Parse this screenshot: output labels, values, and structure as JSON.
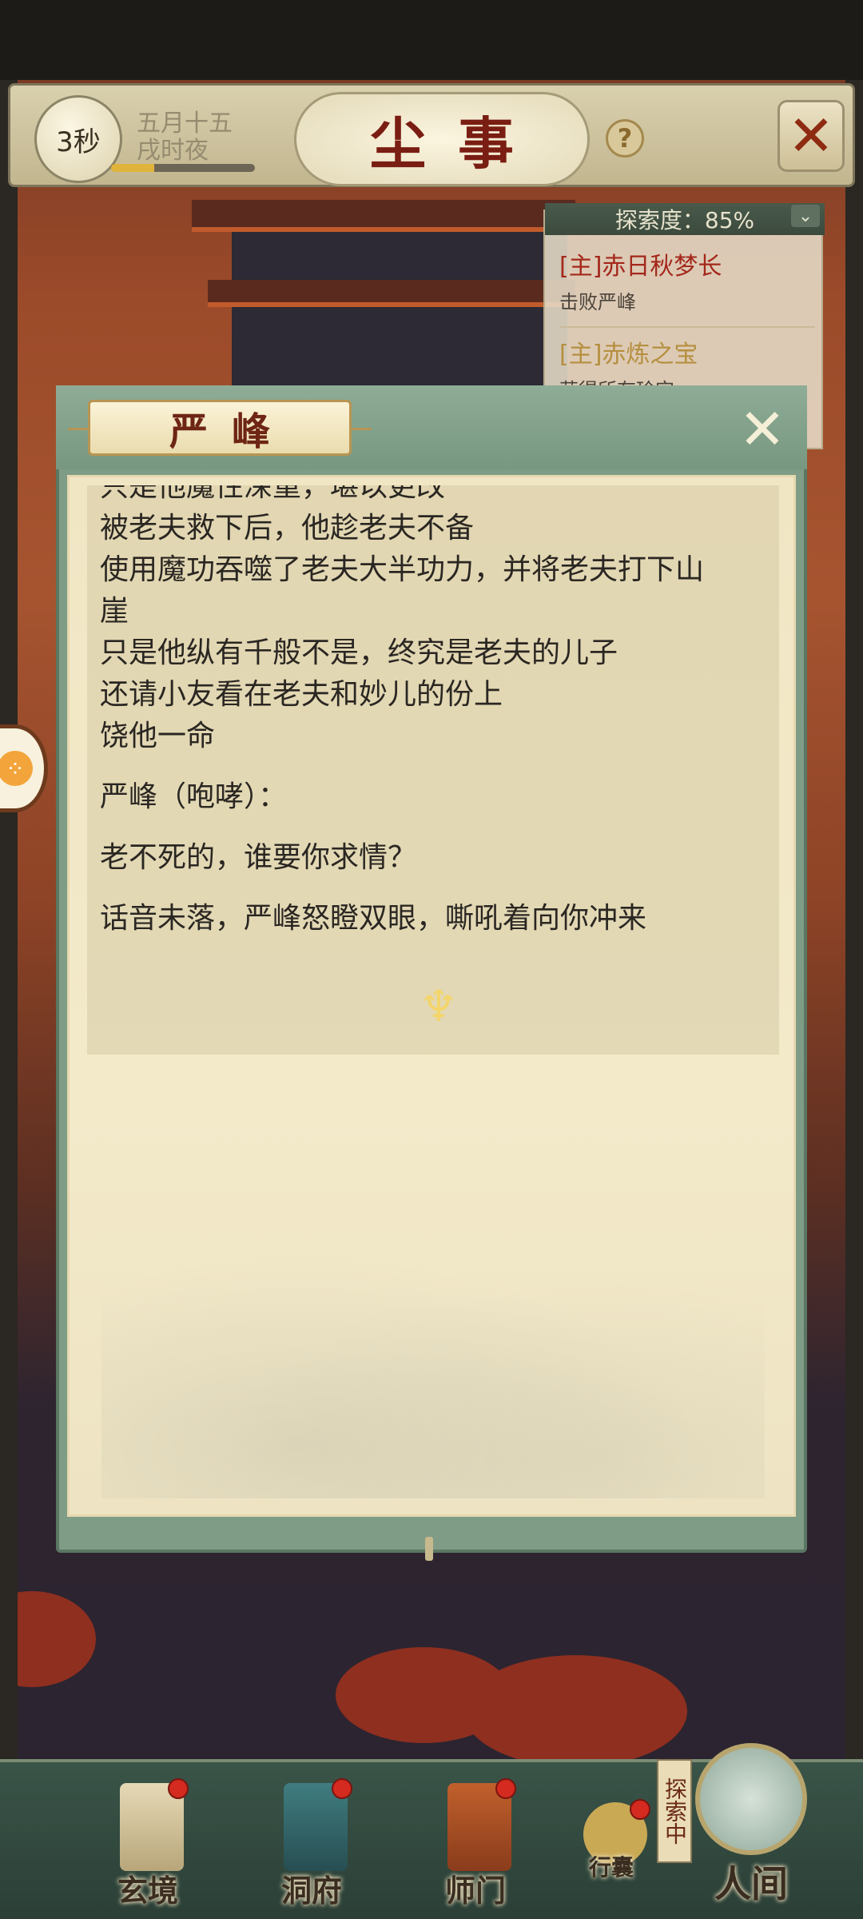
{
  "top_bar": {
    "timer": "3秒",
    "date_line1": "五月十五",
    "date_line2": "戌时夜",
    "progress": 0.3,
    "title": "尘事",
    "help_icon": "question-icon",
    "menu_icon": "crossed-swords-icon"
  },
  "quest_panel": {
    "explore_label": "探索度：85%",
    "quests": [
      {
        "title": "[主]赤日秋梦长",
        "subtitle": "击败严峰",
        "color": "#a4281b"
      },
      {
        "title": "[主]赤炼之宝",
        "subtitle": "获得所有珍宝",
        "color": "#b58f3f"
      }
    ]
  },
  "dialog": {
    "speaker": "严峰",
    "close_icon": "close-icon",
    "continue_icon": "continue-arrow-icon",
    "paragraphs": [
      [
        "只是他魔性深重，堪以更改",
        "被老夫救下后，他趁老夫不备",
        "使用魔功吞噬了老夫大半功力，并将老夫打下山",
        "崖",
        "只是他纵有千般不是，终究是老夫的儿子",
        "还请小友看在老夫和妙儿的份上",
        "饶他一命"
      ],
      [
        "严峰（咆哮）："
      ],
      [
        "老不死的，谁要你求情？"
      ],
      [
        "话音未落，严峰怒瞪双眼，嘶吼着向你冲来"
      ]
    ]
  },
  "bottom_nav": {
    "items": [
      "玄境",
      "洞府",
      "师门",
      "行囊"
    ],
    "explore_tag": "探索中",
    "world": "人间"
  },
  "colors": {
    "dialog_frame": "#7f9c86",
    "paper": "#f1e6c4",
    "badge": "#d42a1f"
  }
}
